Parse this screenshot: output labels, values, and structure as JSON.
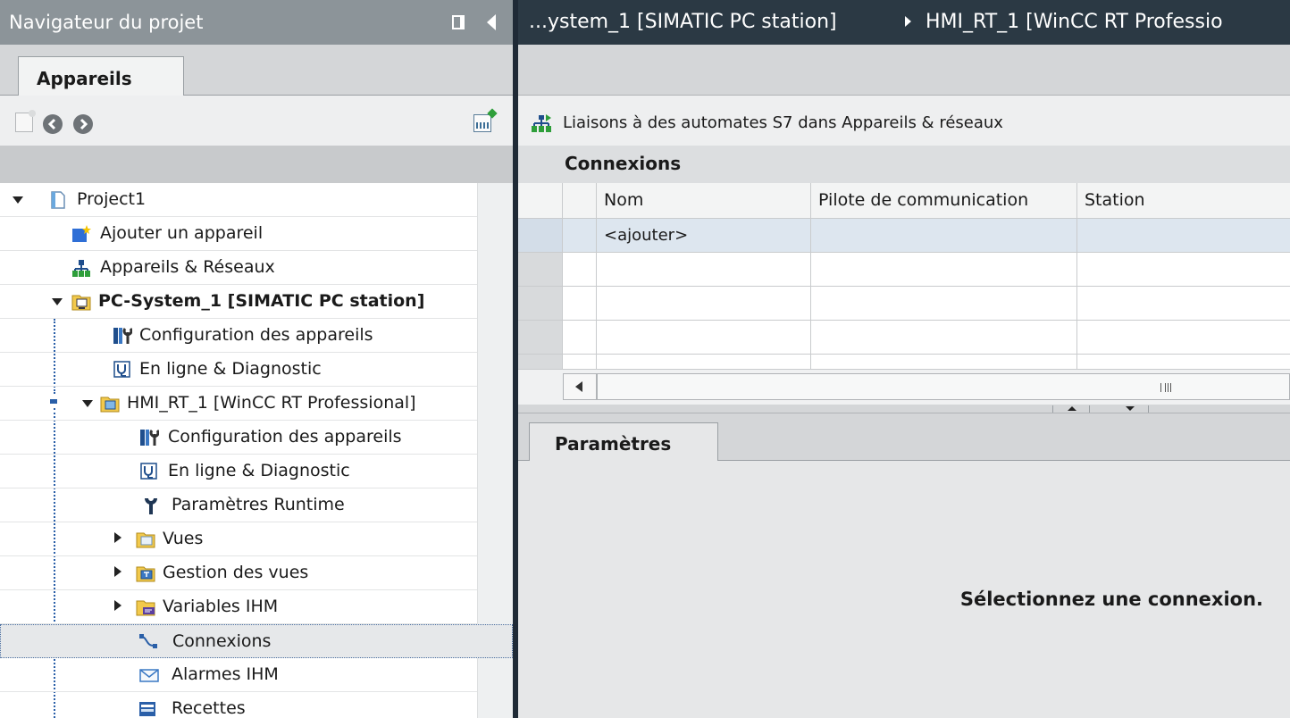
{
  "navigator": {
    "title": "Navigateur du projet",
    "tab_label": "Appareils"
  },
  "tree": {
    "items": [
      {
        "label": "Project1"
      },
      {
        "label": "Ajouter un appareil"
      },
      {
        "label": "Appareils & Réseaux"
      },
      {
        "label": "PC-System_1 [SIMATIC PC station]"
      },
      {
        "label": "Configuration des appareils"
      },
      {
        "label": "En ligne & Diagnostic"
      },
      {
        "label": "HMI_RT_1 [WinCC RT Professional]"
      },
      {
        "label": "Configuration des appareils"
      },
      {
        "label": "En ligne & Diagnostic"
      },
      {
        "label": "Paramètres Runtime"
      },
      {
        "label": "Vues"
      },
      {
        "label": "Gestion des vues"
      },
      {
        "label": "Variables IHM"
      },
      {
        "label": "Connexions"
      },
      {
        "label": "Alarmes IHM"
      },
      {
        "label": "Recettes"
      }
    ],
    "selected_index": 13
  },
  "editor": {
    "breadcrumb": {
      "part1": "...ystem_1 [SIMATIC PC station]",
      "part2": "HMI_RT_1 [WinCC RT Professio"
    },
    "link_text": "Liaisons à des automates S7 dans Appareils & réseaux",
    "section_title": "Connexions",
    "table": {
      "headers": [
        "Nom",
        "Pilote de communication",
        "Station"
      ],
      "add_row": "<ajouter>"
    }
  },
  "properties": {
    "tab_label": "Paramètres",
    "message": "Sélectionnez une connexion."
  },
  "colors": {
    "title_bar": "#8c9499",
    "breadcrumb_bar": "#2b3944",
    "splitter": "#1f2a36",
    "selection_border": "#4a6ea0"
  }
}
